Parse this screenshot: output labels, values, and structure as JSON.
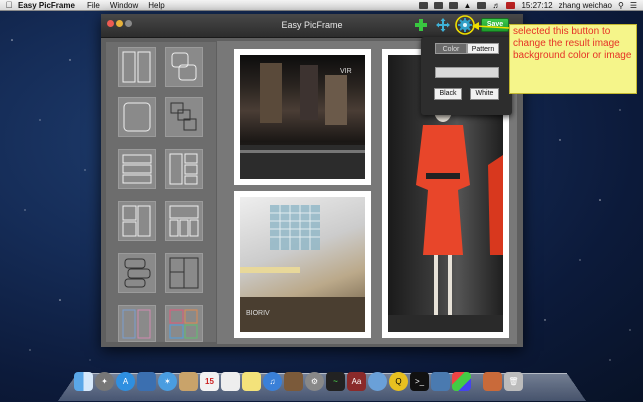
{
  "menubar": {
    "app_name": "Easy PicFrame",
    "menus": [
      "File",
      "Window",
      "Help"
    ],
    "time": "15:27:12",
    "user": "zhang weichao"
  },
  "window": {
    "title": "Easy PicFrame",
    "save_label": "Save",
    "toolbar_icons": [
      "add-icon",
      "move-icon",
      "gear-icon"
    ]
  },
  "popover": {
    "tabs": [
      "Color",
      "Pattern"
    ],
    "selected_tab": "Pattern",
    "buttons": [
      "Black",
      "White"
    ]
  },
  "annotation": {
    "text": "selected this button to change the result image background color or image"
  },
  "colors": {
    "accent_green": "#2fb53c",
    "annotation_bg": "#f5f58a",
    "annotation_text": "#e53226",
    "highlight_ring": "#f0e000"
  }
}
